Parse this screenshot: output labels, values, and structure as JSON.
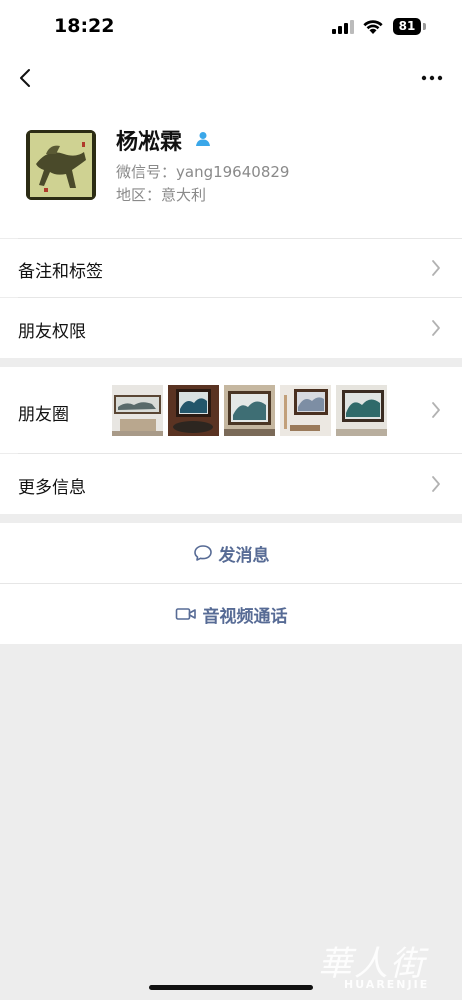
{
  "status_bar": {
    "time": "18:22",
    "battery": "81"
  },
  "profile": {
    "name": "杨凇霖",
    "wechat_id": "微信号：yang19640829",
    "region": "地区：意大利"
  },
  "menu": {
    "remarks_tags": "备注和标签",
    "friend_permissions": "朋友权限",
    "moments": "朋友圈",
    "more_info": "更多信息"
  },
  "actions": {
    "send_message": "发消息",
    "video_call": "音视频通话"
  },
  "watermark": {
    "cn": "華人街",
    "en": "HUARENJIE"
  },
  "colors": {
    "accent": "#576b95",
    "contact_icon": "#3aa7e9",
    "background": "#ededed"
  }
}
